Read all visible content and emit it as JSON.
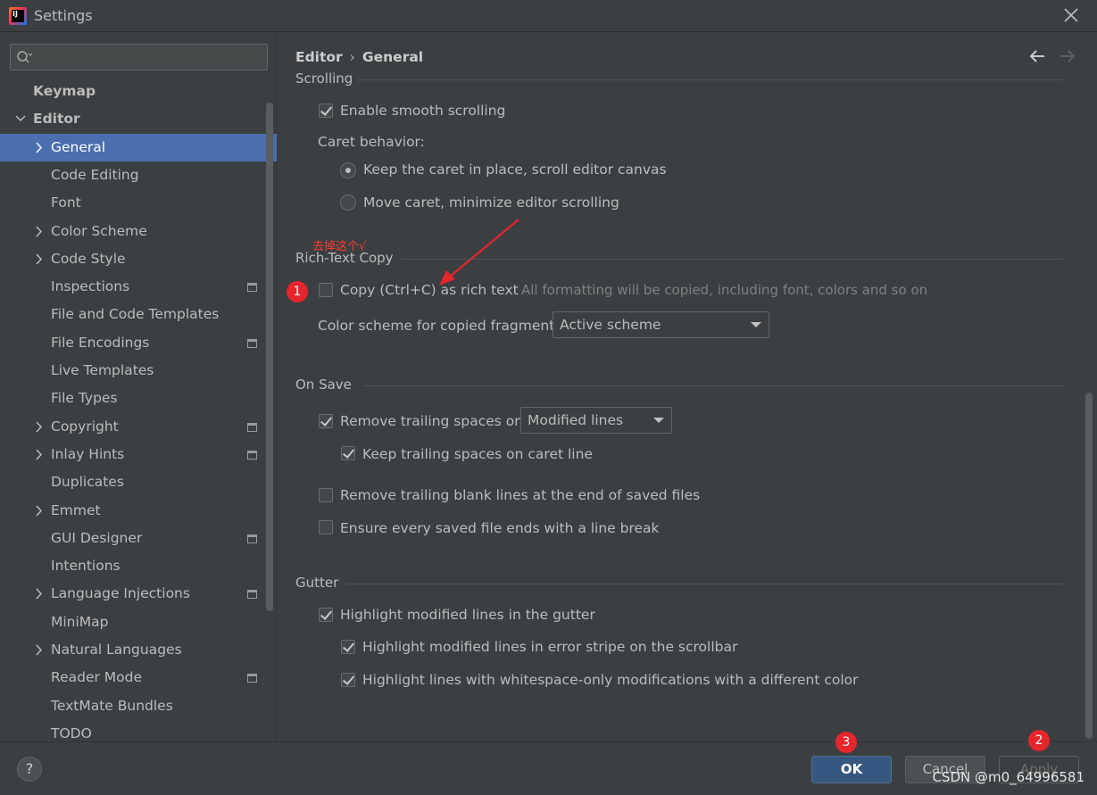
{
  "window": {
    "title": "Settings",
    "icon": "intellij-idea-icon"
  },
  "search": {
    "placeholder": ""
  },
  "sidebar": {
    "items": [
      {
        "label": "Keymap",
        "bold": true
      },
      {
        "label": "Editor",
        "bold": true,
        "expanded": true
      },
      {
        "label": "General",
        "selected": true,
        "expandable": true
      },
      {
        "label": "Code Editing"
      },
      {
        "label": "Font"
      },
      {
        "label": "Color Scheme",
        "expandable": true
      },
      {
        "label": "Code Style",
        "expandable": true
      },
      {
        "label": "Inspections",
        "project_icon": true
      },
      {
        "label": "File and Code Templates"
      },
      {
        "label": "File Encodings",
        "project_icon": true
      },
      {
        "label": "Live Templates"
      },
      {
        "label": "File Types"
      },
      {
        "label": "Copyright",
        "expandable": true,
        "project_icon": true
      },
      {
        "label": "Inlay Hints",
        "expandable": true,
        "project_icon": true
      },
      {
        "label": "Duplicates"
      },
      {
        "label": "Emmet",
        "expandable": true
      },
      {
        "label": "GUI Designer",
        "project_icon": true
      },
      {
        "label": "Intentions"
      },
      {
        "label": "Language Injections",
        "expandable": true,
        "project_icon": true
      },
      {
        "label": "MiniMap"
      },
      {
        "label": "Natural Languages",
        "expandable": true
      },
      {
        "label": "Reader Mode",
        "project_icon": true
      },
      {
        "label": "TextMate Bundles"
      },
      {
        "label": "TODO"
      }
    ]
  },
  "breadcrumb": {
    "parent": "Editor",
    "sep": "›",
    "current": "General"
  },
  "scrolling": {
    "title": "Scrolling",
    "smooth_label": "Enable smooth scrolling",
    "smooth_checked": true,
    "caret_title": "Caret behavior:",
    "caret_option1": "Keep the caret in place, scroll editor canvas",
    "caret_option2": "Move caret, minimize editor scrolling",
    "caret_selected": 1
  },
  "rich_text": {
    "title": "Rich-Text Copy",
    "copy_label": "Copy (Ctrl+C) as rich text",
    "copy_checked": false,
    "copy_hint": "All formatting will be copied, including font, colors and so on",
    "scheme_label": "Color scheme for copied fragment:",
    "scheme_value": "Active scheme"
  },
  "on_save": {
    "title": "On Save",
    "remove_trailing_label": "Remove trailing spaces on:",
    "remove_trailing_checked": true,
    "remove_trailing_value": "Modified lines",
    "keep_caret_label": "Keep trailing spaces on caret line",
    "keep_caret_checked": true,
    "remove_blank_label": "Remove trailing blank lines at the end of saved files",
    "remove_blank_checked": false,
    "ensure_break_label": "Ensure every saved file ends with a line break",
    "ensure_break_checked": false
  },
  "gutter": {
    "title": "Gutter",
    "highlight_label": "Highlight modified lines in the gutter",
    "highlight_checked": true,
    "error_stripe_label": "Highlight modified lines in error stripe on the scrollbar",
    "error_stripe_checked": true,
    "whitespace_label": "Highlight lines with whitespace-only modifications with a different color",
    "whitespace_checked": true
  },
  "annotations": {
    "note": "去掉这个√",
    "badge1": "1",
    "badge2": "2",
    "badge3": "3",
    "color": "#e5262c"
  },
  "footer": {
    "help_label": "?",
    "ok_label": "OK",
    "cancel_label": "Cancel",
    "apply_label": "Apply",
    "watermark": "CSDN @m0_64996581"
  },
  "colors": {
    "background": "#3c3f41",
    "selection": "#4b6eaf",
    "primary_button": "#365880",
    "text": "#bbbbbb"
  }
}
